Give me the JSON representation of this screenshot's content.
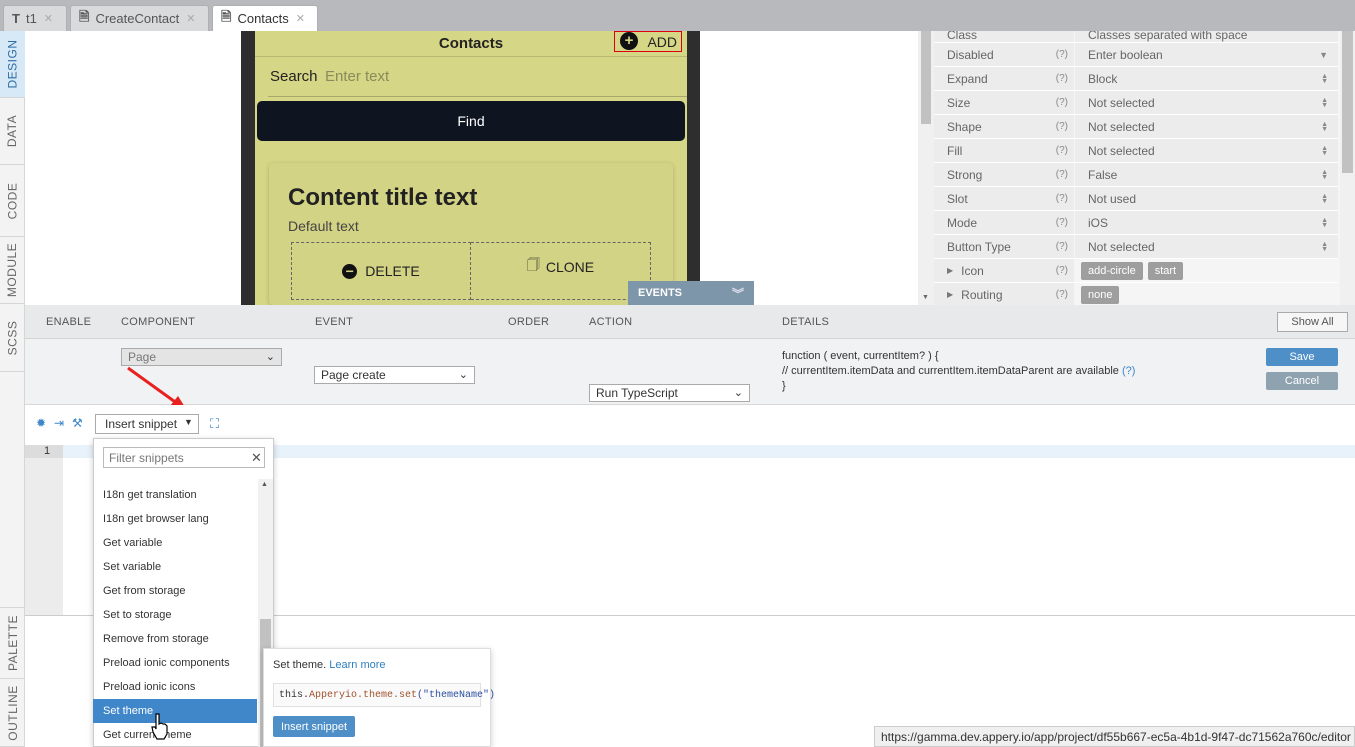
{
  "tabs": [
    {
      "label": "t1",
      "icon": "text-icon"
    },
    {
      "label": "CreateContact",
      "icon": "page-icon"
    },
    {
      "label": "Contacts",
      "icon": "page-icon"
    }
  ],
  "left_tabs": [
    "DESIGN",
    "DATA",
    "CODE",
    "MODULE",
    "SCSS",
    "PALETTE",
    "OUTLINE"
  ],
  "phone": {
    "header_title": "Contacts",
    "add_label": "ADD",
    "search_label": "Search",
    "search_placeholder": "Enter text",
    "find_label": "Find",
    "card_title": "Content title text",
    "card_text": "Default text",
    "delete_label": "DELETE",
    "clone_label": "CLONE"
  },
  "props": {
    "class_row": {
      "label": "Class",
      "value": "Classes separated with space"
    },
    "rows": [
      {
        "label": "Disabled",
        "q": "(?)",
        "value": "Enter boolean"
      },
      {
        "label": "Expand",
        "q": "(?)",
        "value": "Block"
      },
      {
        "label": "Size",
        "q": "(?)",
        "value": "Not selected"
      },
      {
        "label": "Shape",
        "q": "(?)",
        "value": "Not selected"
      },
      {
        "label": "Fill",
        "q": "(?)",
        "value": "Not selected"
      },
      {
        "label": "Strong",
        "q": "(?)",
        "value": "False"
      },
      {
        "label": "Slot",
        "q": "(?)",
        "value": "Not used"
      },
      {
        "label": "Mode",
        "q": "(?)",
        "value": "iOS"
      },
      {
        "label": "Button Type",
        "q": "(?)",
        "value": "Not selected"
      }
    ],
    "icon_row": {
      "label": "Icon",
      "q": "(?)",
      "chips": [
        "add-circle",
        "start"
      ]
    },
    "routing_row": {
      "label": "Routing",
      "q": "(?)",
      "chips": [
        "none"
      ]
    }
  },
  "events": {
    "title": "EVENTS",
    "columns": [
      "ENABLE",
      "COMPONENT",
      "EVENT",
      "ORDER",
      "ACTION",
      "DETAILS"
    ],
    "show_all": "Show All",
    "component": "Page",
    "event": "Page create",
    "action": "Run TypeScript",
    "details_line1": "function ( event, currentItem? ) {",
    "details_line2": "// currentItem.itemData and currentItem.itemDataParent are available",
    "details_q": "(?)",
    "details_line3": "}",
    "save": "Save",
    "cancel": "Cancel"
  },
  "editor": {
    "insert_snippet": "Insert snippet",
    "line_number": "1",
    "filter_placeholder": "Filter snippets",
    "snippets": [
      "I18n get translation",
      "I18n get browser lang",
      "Get variable",
      "Set variable",
      "Get from storage",
      "Set to storage",
      "Remove from storage",
      "Preload ionic components",
      "Preload ionic icons",
      "Set theme",
      "Get current theme"
    ],
    "highlighted_index": 9
  },
  "popup": {
    "text": "Set theme.",
    "link": "Learn more",
    "code_prefix": "this.",
    "code_obj": "Apperyio.theme.set",
    "code_arg": "(\"themeName\")",
    "button": "Insert snippet"
  },
  "status_url": "https://gamma.dev.appery.io/app/project/df55b667-ec5a-4b1d-9f47-dc71562a760c/editor",
  "colors": {
    "accent": "#3f87c9",
    "phone_bg": "#d6d687",
    "find_button": "#0e1521",
    "events_bar": "#7d96a9",
    "arrow": "#e8201e"
  }
}
